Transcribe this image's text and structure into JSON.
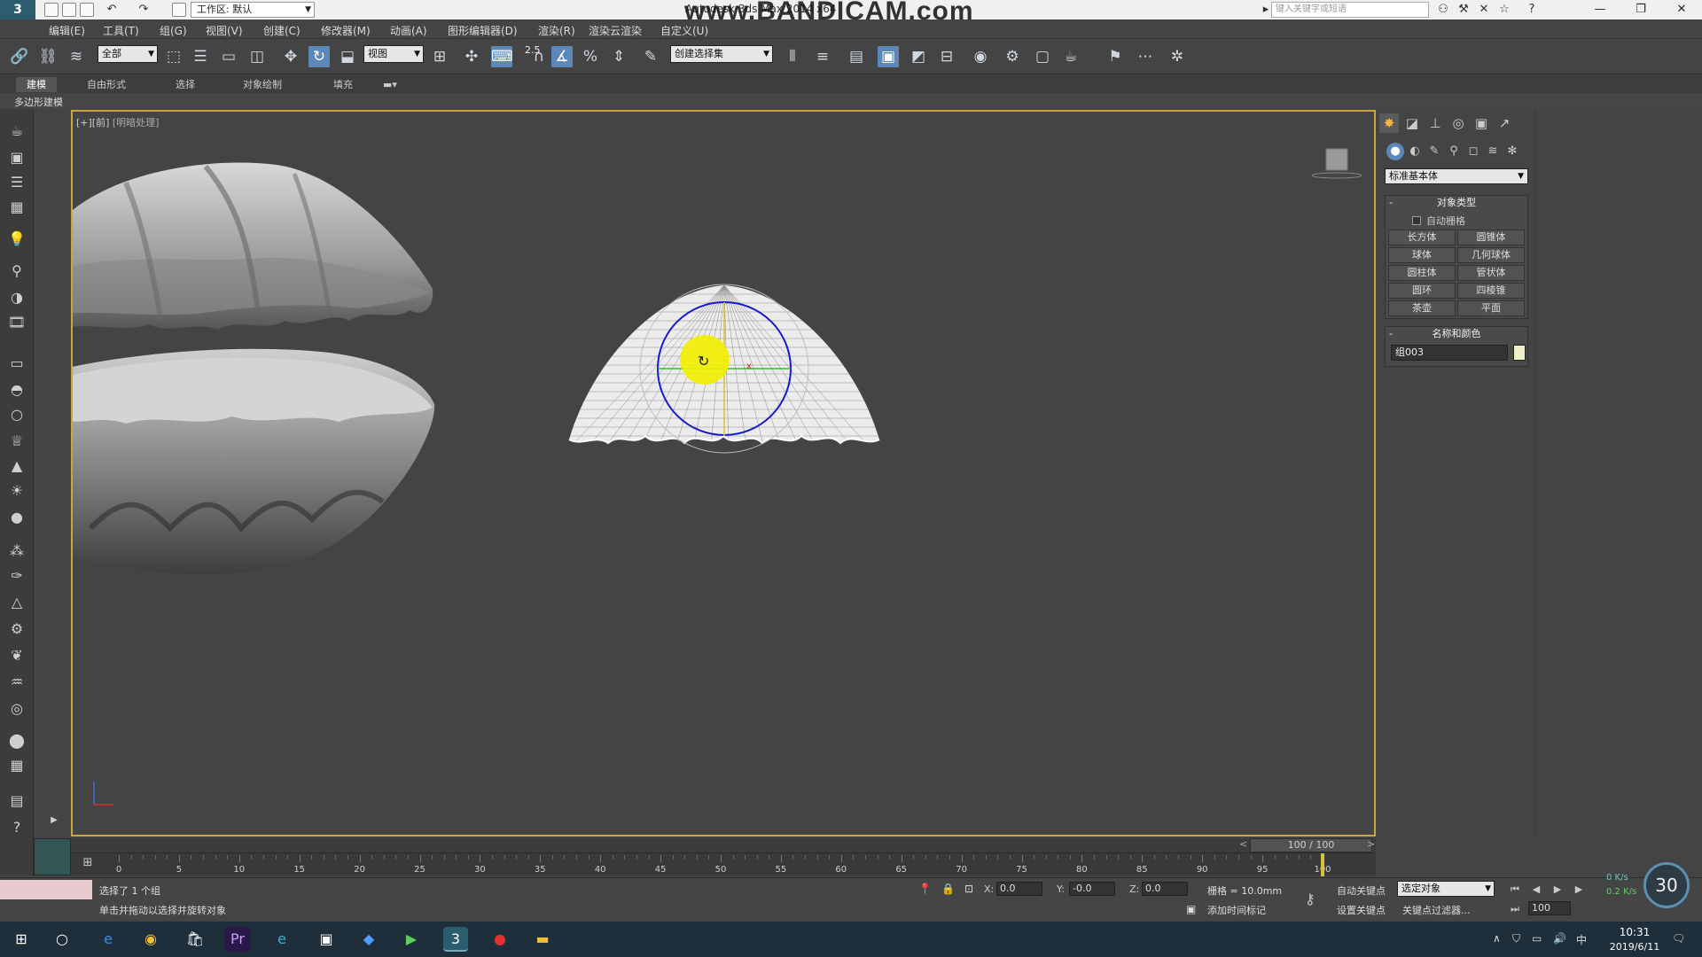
{
  "titlebar": {
    "app_title": "Autodesk 3ds Max  2014 x64",
    "watermark": "www.BANDICAM.com",
    "workspace": "工作区: 默认",
    "search_placeholder": "键入关键字或短语",
    "icons": [
      "new-file-icon",
      "open-file-icon",
      "save-icon",
      "undo-icon",
      "redo-icon",
      "project-folder-icon",
      "binoculars-icon",
      "tools-icon",
      "star-icon",
      "help-icon"
    ]
  },
  "menu": {
    "items": [
      "编辑(E)",
      "工具(T)",
      "组(G)",
      "视图(V)",
      "创建(C)",
      "修改器(M)",
      "动画(A)",
      "图形编辑器(D)",
      "渲染(R)",
      "渲染云渲染",
      "自定义(U)"
    ]
  },
  "toolbar": {
    "selection_filter": "全部",
    "ref_coord": "视图",
    "angle_snap_value": "2.5",
    "named_selection": "创建选择集"
  },
  "ribbon": {
    "tabs": [
      "建模",
      "自由形式",
      "选择",
      "对象绘制",
      "填充"
    ],
    "active_tab": "建模",
    "sub_label": "多边形建模"
  },
  "viewport": {
    "label_prefix": "[+][前]",
    "label_shading": "[明暗处理]"
  },
  "command_panel": {
    "category": "标准基本体",
    "object_type_title": "对象类型",
    "auto_grid": "自动栅格",
    "buttons": [
      "长方体",
      "圆锥体",
      "球体",
      "几何球体",
      "圆柱体",
      "管状体",
      "圆环",
      "四棱锥",
      "茶壶",
      "平面"
    ],
    "name_color_title": "名称和颜色",
    "object_name": "组003",
    "swatch_color": "#efefc8"
  },
  "timeline": {
    "frame_display": "100 / 100",
    "prev": "<",
    "next": ">",
    "ticks": [
      "0",
      "5",
      "10",
      "15",
      "20",
      "25",
      "30",
      "35",
      "40",
      "45",
      "50",
      "55",
      "60",
      "65",
      "70",
      "75",
      "80",
      "85",
      "90",
      "95",
      "100"
    ]
  },
  "status": {
    "line1": "选择了 1 个组",
    "line2": "单击并拖动以选择并旋转对象",
    "x_label": "X:",
    "x_value": "0.0",
    "y_label": "Y:",
    "y_value": "-0.0",
    "z_label": "Z:",
    "z_value": "0.0",
    "grid": "栅格 = 10.0mm",
    "add_time_tag": "添加时间标记",
    "auto_key": "自动关键点",
    "set_key": "设置关键点",
    "selected_object": "选定对象",
    "key_filters": "关键点过滤器...",
    "frame": "100",
    "speed_up": "0 K/s",
    "speed_down": "0.2 K/s",
    "fps": "30"
  },
  "taskbar": {
    "time": "10:31",
    "date": "2019/6/11",
    "ime": "中"
  },
  "colors": {
    "active_border": "#c8a83a",
    "active_tool": "#5b88b8",
    "viewport_bg": "#444444",
    "wire": "#ffffff",
    "gizmo_blue": "#1a1ac8",
    "highlight_yellow": "#f3f000"
  }
}
